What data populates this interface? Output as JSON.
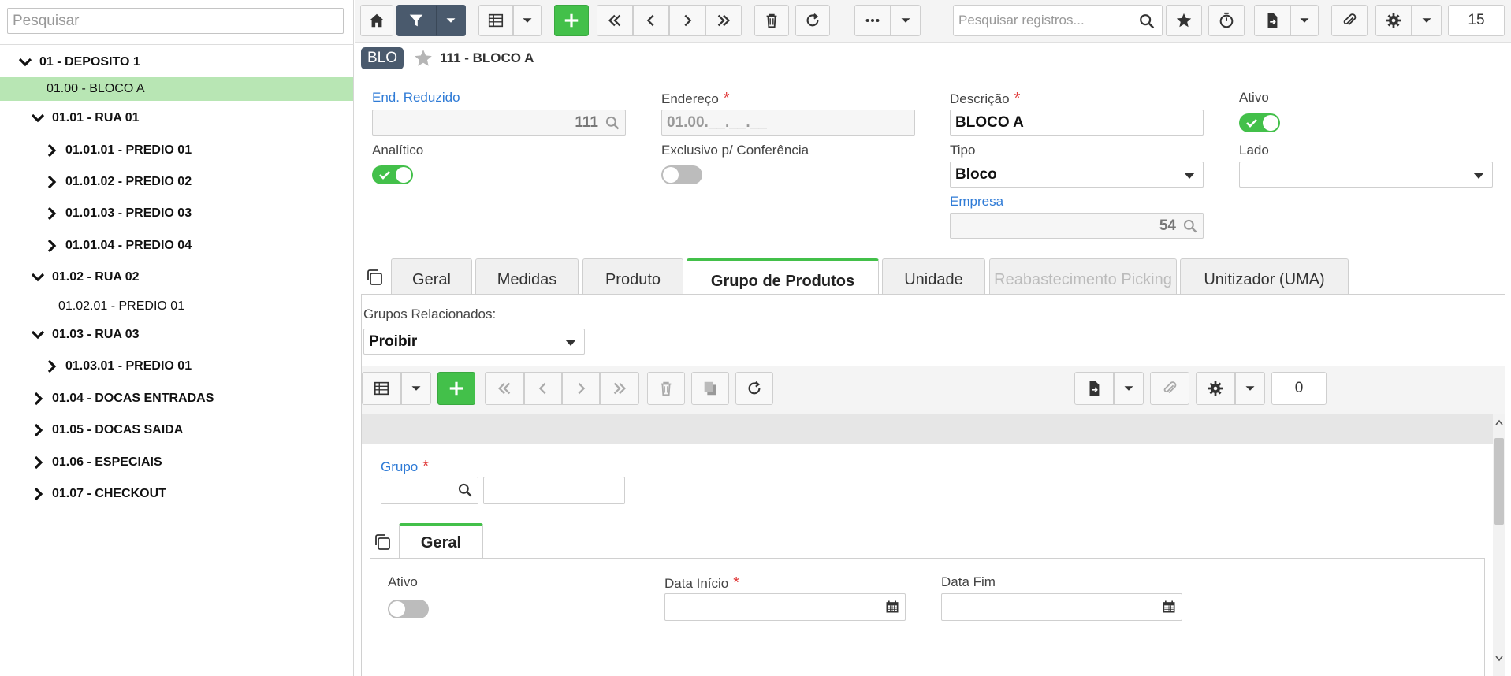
{
  "left_panel": {
    "search_placeholder": "Pesquisar",
    "tree": [
      {
        "label": "01 - DEPOSITO 1"
      },
      {
        "label": "01.00 - BLOCO A"
      },
      {
        "label": "01.01 - RUA 01"
      },
      {
        "label": "01.01.01 - PREDIO 01"
      },
      {
        "label": "01.01.02 - PREDIO 02"
      },
      {
        "label": "01.01.03 - PREDIO 03"
      },
      {
        "label": "01.01.04 - PREDIO 04"
      },
      {
        "label": "01.02 - RUA 02"
      },
      {
        "label": "01.02.01 - PREDIO 01"
      },
      {
        "label": "01.03 - RUA 03"
      },
      {
        "label": "01.03.01 - PREDIO 01"
      },
      {
        "label": "01.04 - DOCAS ENTRADAS"
      },
      {
        "label": "01.05 - DOCAS SAIDA"
      },
      {
        "label": "01.06 - ESPECIAIS"
      },
      {
        "label": "01.07 - CHECKOUT"
      }
    ]
  },
  "toolbar": {
    "search_placeholder": "Pesquisar registros...",
    "record_count": "15"
  },
  "breadcrumb": {
    "badge": "BLO",
    "title": "111 - BLOCO A"
  },
  "form": {
    "end_reduzido_label": "End. Reduzido",
    "end_reduzido_value": "111",
    "endereco_label": "Endereço",
    "endereco_value": "01.00.__.__.__",
    "descricao_label": "Descrição",
    "descricao_value": "BLOCO A",
    "ativo_label": "Ativo",
    "ativo_on": true,
    "analitico_label": "Analítico",
    "analitico_on": true,
    "exclusivo_label": "Exclusivo p/ Conferência",
    "exclusivo_on": false,
    "tipo_label": "Tipo",
    "tipo_value": "Bloco",
    "lado_label": "Lado",
    "lado_value": "",
    "empresa_label": "Empresa",
    "empresa_value": "54",
    "required_mark": "*"
  },
  "tabs": [
    {
      "label": "Geral"
    },
    {
      "label": "Medidas"
    },
    {
      "label": "Produto"
    },
    {
      "label": "Grupo de Produtos",
      "active": true
    },
    {
      "label": "Unidade"
    },
    {
      "label": "Reabastecimento Picking",
      "disabled": true
    },
    {
      "label": "Unitizador (UMA)"
    }
  ],
  "grupo_panel": {
    "grupos_label": "Grupos Relacionados:",
    "grupos_value": "Proibir",
    "sub_count": "0",
    "grupo_label": "Grupo",
    "inner_tab": "Geral",
    "ativo_label": "Ativo",
    "ativo_on": false,
    "data_inicio_label": "Data Início",
    "data_fim_label": "Data Fim"
  },
  "colors": {
    "accent_green": "#43c04a",
    "dark_slate": "#4a5a6d",
    "link_blue": "#2f7bd6",
    "required_red": "#e13b3b",
    "selected_row": "#b8e6b4"
  }
}
